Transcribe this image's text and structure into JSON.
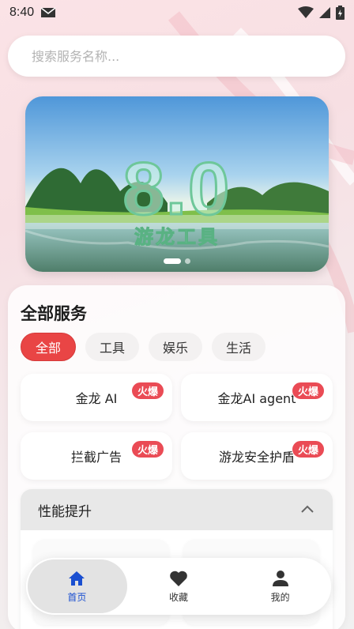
{
  "status_bar": {
    "time": "8:40"
  },
  "search": {
    "placeholder": "搜索服务名称..."
  },
  "banner": {
    "big_text": "8.0",
    "subtitle": "游龙工具"
  },
  "services": {
    "title": "全部服务",
    "tabs": [
      "全部",
      "工具",
      "娱乐",
      "生活"
    ],
    "active_tab": "全部",
    "cards": [
      {
        "label": "金龙 AI",
        "badge": "火爆"
      },
      {
        "label": "金龙AI agent",
        "badge": "火爆"
      },
      {
        "label": "拦截广告",
        "badge": "火爆"
      },
      {
        "label": "游龙安全护盾",
        "badge": "火爆"
      }
    ]
  },
  "accordion": {
    "title": "性能提升",
    "expanded": true
  },
  "bottom_nav": {
    "items": [
      {
        "label": "首页",
        "icon": "home-icon",
        "active": true
      },
      {
        "label": "收藏",
        "icon": "heart-icon",
        "active": false
      },
      {
        "label": "我的",
        "icon": "person-icon",
        "active": false
      }
    ]
  },
  "colors": {
    "accent": "#e94545",
    "nav_active": "#1a4fd0",
    "badge": "#ea4b55"
  }
}
